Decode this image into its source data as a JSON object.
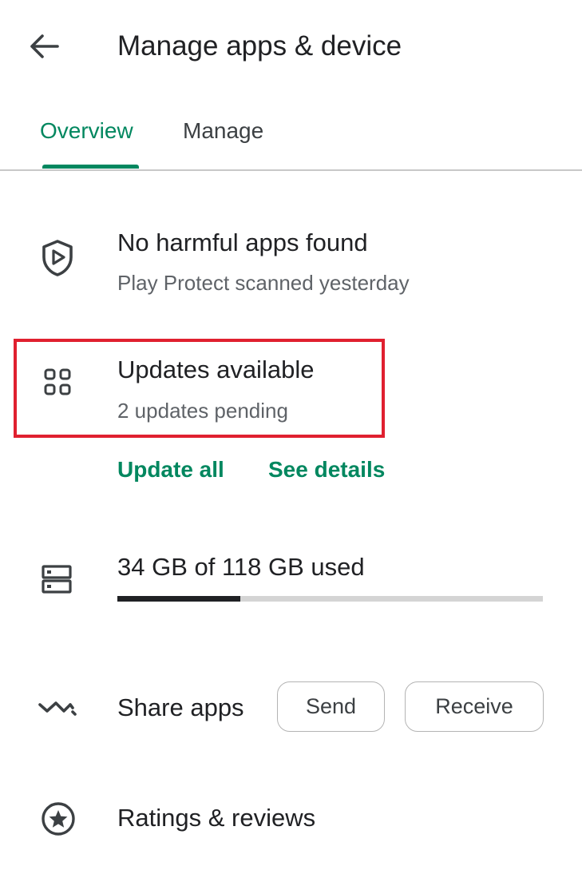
{
  "header": {
    "title": "Manage apps & device",
    "back_icon": "arrow-back-icon"
  },
  "tabs": [
    {
      "label": "Overview",
      "selected": true
    },
    {
      "label": "Manage",
      "selected": false
    }
  ],
  "protect": {
    "icon": "play-protect-shield-icon",
    "title": "No harmful apps found",
    "subtitle": "Play Protect scanned yesterday"
  },
  "updates": {
    "icon": "apps-grid-icon",
    "title": "Updates available",
    "subtitle": "2 updates pending",
    "highlight_color": "#e0202f"
  },
  "update_actions": {
    "update_all": "Update all",
    "see_details": "See details"
  },
  "storage": {
    "icon": "storage-icon",
    "text": "34 GB of 118 GB used",
    "used_gb": 34,
    "total_gb": 118
  },
  "share": {
    "icon": "share-apps-icon",
    "label": "Share apps",
    "send": "Send",
    "receive": "Receive"
  },
  "ratings": {
    "icon": "star-circle-icon",
    "label": "Ratings & reviews"
  },
  "colors": {
    "accent": "#01875f",
    "text": "#202124",
    "secondary_text": "#5f6368"
  }
}
